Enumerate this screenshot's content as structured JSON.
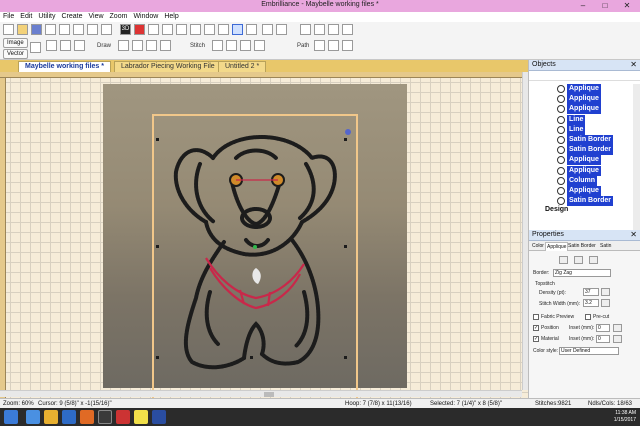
{
  "window": {
    "title": "Embrilliance - Maybelle working files *",
    "min": "–",
    "max": "□",
    "close": "✕"
  },
  "menu": [
    "File",
    "Edit",
    "Utility",
    "Create",
    "View",
    "Zoom",
    "Window",
    "Help"
  ],
  "toolbar": {
    "image_label": "Image",
    "vector_label": "Vector",
    "draw_label": "Draw",
    "stitch_label": "Stitch",
    "path_label": "Path",
    "view3d_label": "3D"
  },
  "tabs": [
    {
      "label": "Maybelle working files *",
      "active": true
    },
    {
      "label": "Labrador Piecing Working File",
      "active": false
    },
    {
      "label": "Untitled 2 *",
      "active": false
    }
  ],
  "objects_panel": {
    "title": "Objects",
    "items": [
      {
        "num": "",
        "label": "Applique"
      },
      {
        "num": "",
        "label": "Applique"
      },
      {
        "num": "",
        "label": "Applique"
      },
      {
        "num": "",
        "label": "Line"
      },
      {
        "num": "",
        "label": "Line"
      },
      {
        "num": "",
        "label": "Satin Border"
      },
      {
        "num": "",
        "label": "Satin Border"
      },
      {
        "num": "",
        "label": "Applique"
      },
      {
        "num": "",
        "label": "Applique"
      },
      {
        "num": "",
        "label": "Column"
      },
      {
        "num": "",
        "label": "Applique"
      },
      {
        "num": "",
        "label": "Satin Border"
      }
    ],
    "design_label": "Design"
  },
  "properties_panel": {
    "title": "Properties",
    "tabs": [
      "Color",
      "Applique",
      "Satin Border",
      "Satin"
    ],
    "border_label": "Border:",
    "border_value": "Zig Zag",
    "topstitch_label": "Topstitch",
    "density_label": "Density (pt):",
    "density_value": "37",
    "stitch_width_label": "Stitch Width (mm):",
    "stitch_width_value": "3.2",
    "fabric_preview_label": "Fabric Preview",
    "precut_label": "Pre-cut",
    "position_label": "Position",
    "inset_label_1": "Inset (mm):",
    "inset_value_1": "0",
    "material_label": "Material",
    "inset_label_2": "Inset (mm):",
    "inset_value_2": "0",
    "color_style_label": "Color style:",
    "color_style_value": "User Defined"
  },
  "status": {
    "zoom": "Zoom: 60%",
    "cursor": "Cursor: 9 (5/8)\" x -1(15/16)\"",
    "hoop": "Hoop: 7 (7/8) x 11(13/16)",
    "selected": "Selected: 7 (1/4)\" x 8 (5/8)\"",
    "stitches": "Stitches:9821",
    "ndls": "Ndls/Cols: 18/63"
  },
  "clock": {
    "time": "11:38 AM",
    "date": "1/15/2017"
  },
  "colors": {
    "titlebar": "#e9a7de",
    "tabstrip": "#e8c76a",
    "selection": "#2040d0",
    "stitch": "#1c1c1c",
    "accent_red": "#c8284a",
    "hoop": "#f1c78a"
  }
}
